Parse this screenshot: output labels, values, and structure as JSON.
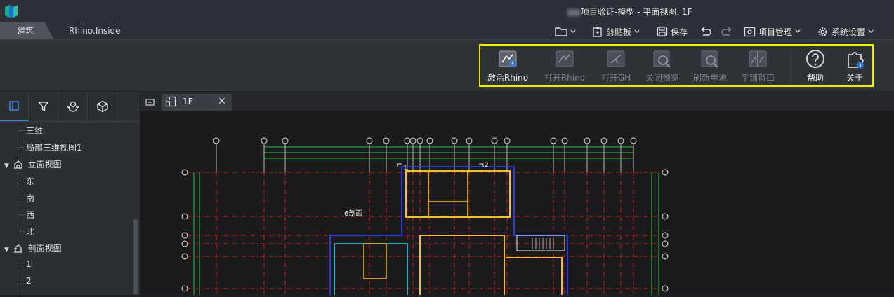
{
  "titlebar": {
    "title": "项目验证-模型 - 平面视图: 1F"
  },
  "tabs": [
    {
      "label": "建筑"
    },
    {
      "label": "Rhino.Inside"
    }
  ],
  "toolbar": {
    "clipboard_label": "剪贴板",
    "save_label": "保存",
    "project_label": "项目管理",
    "settings_label": "系统设置"
  },
  "ribbon": {
    "buttons": [
      {
        "label": "激活Rhino",
        "enabled": true,
        "icon": "rhino-activate-icon"
      },
      {
        "label": "打开Rhino",
        "enabled": false,
        "icon": "rhino-open-icon"
      },
      {
        "label": "打开GH",
        "enabled": false,
        "icon": "grasshopper-icon"
      },
      {
        "label": "关闭预览",
        "enabled": false,
        "icon": "preview-off-icon"
      },
      {
        "label": "刷新电池",
        "enabled": false,
        "icon": "refresh-component-icon"
      },
      {
        "label": "平铺窗口",
        "enabled": false,
        "icon": "tile-windows-icon"
      },
      {
        "label": "帮助",
        "enabled": true,
        "icon": "help-icon"
      },
      {
        "label": "关于",
        "enabled": true,
        "icon": "about-plugin-icon"
      }
    ],
    "highlight_color": "#f2ee00"
  },
  "browser": {
    "tree": [
      {
        "label": "三维"
      },
      {
        "label": "局部三维视图1"
      },
      {
        "label": "立面视图",
        "group": true
      },
      {
        "label": "东"
      },
      {
        "label": "南"
      },
      {
        "label": "西"
      },
      {
        "label": "北"
      },
      {
        "label": "剖面视图",
        "group": true
      },
      {
        "label": "1"
      },
      {
        "label": "2"
      }
    ]
  },
  "view": {
    "tab_label": "1F",
    "plan_labels": {
      "room": "6剖面",
      "sec1": "1",
      "sec2": "2"
    }
  },
  "colors": {
    "accent": "#3b7ed6",
    "grid": "#d11f1f",
    "wall": "#f0c030"
  }
}
